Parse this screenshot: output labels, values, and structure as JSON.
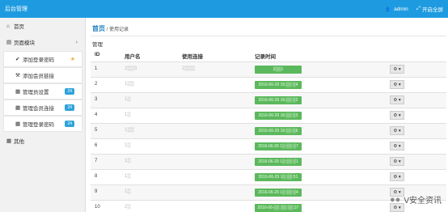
{
  "app_title": "后台管理",
  "topbar": {
    "user_icon": "users-icon",
    "user": "admin",
    "fullscreen_icon": "fullscreen-icon",
    "fullscreen": "开启全屏"
  },
  "sidebar": {
    "items": [
      {
        "icon": "home-icon",
        "label": "首页"
      },
      {
        "icon": "file-icon",
        "label": "页面模块"
      },
      {
        "icon": "check-icon",
        "label": "添加登录密码"
      },
      {
        "icon": "wrench-icon",
        "label": "添加会员链接"
      },
      {
        "icon": "grid-icon",
        "label": "管理员设置",
        "badge": "24"
      },
      {
        "icon": "grid-icon",
        "label": "管理会员连接",
        "badge": "24"
      },
      {
        "icon": "grid-icon",
        "label": "管理登录密码",
        "badge": "24"
      },
      {
        "icon": "table-icon",
        "label": "其他"
      }
    ]
  },
  "breadcrumb": {
    "home": "首页",
    "sep": "/",
    "current": "使用记录"
  },
  "section_title": "管理",
  "table": {
    "headers": [
      "ID",
      "用户名",
      "使用连接",
      "记录时间"
    ],
    "rows": [
      {
        "id": "1",
        "user": "2▒▒3",
        "link": "2▒▒▒",
        "time": "2▒▒1"
      },
      {
        "id": "2",
        "user": "1▒▒",
        "link": "",
        "time": "2016-06-29 16:▒▒:▒4"
      },
      {
        "id": "3",
        "user": "1▒",
        "link": "",
        "time": "2016-06-29 16:▒▒:▒2"
      },
      {
        "id": "4",
        "user": "1▒",
        "link": "",
        "time": "2016-06-29 16:▒▒:▒3"
      },
      {
        "id": "5",
        "user": "1▒▒",
        "link": "",
        "time": "2016-06-29 16:▒▒:▒6"
      },
      {
        "id": "6",
        "user": "1▒",
        "link": "",
        "time": "2016-06-29 1▒:▒▒:▒7"
      },
      {
        "id": "7",
        "user": "1▒",
        "link": "",
        "time": "2016-06-29 1▒:▒▒:▒1"
      },
      {
        "id": "8",
        "user": "1▒",
        "link": "",
        "time": "2016-06-29 1▒:▒▒:51"
      },
      {
        "id": "9",
        "user": "1▒",
        "link": "",
        "time": "2016-06-29 1▒:▒▒:▒4"
      },
      {
        "id": "10",
        "user": "2▒",
        "link": "",
        "time": "2016-06-▒▒ ▒▒:▒▒:37"
      }
    ],
    "action_icon": "gear-icon",
    "action_label": "⚙ ▾"
  },
  "watermark": "V安全资讯"
}
